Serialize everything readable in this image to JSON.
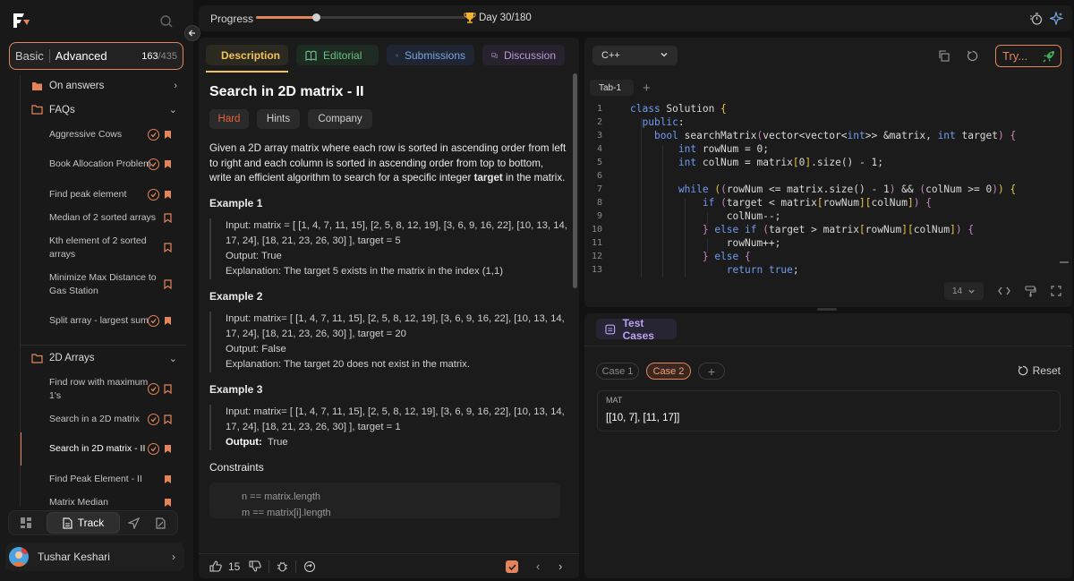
{
  "sidebar": {
    "mode_basic": "Basic",
    "mode_advanced": "Advanced",
    "count_done": "163",
    "count_total": "/435",
    "items": [
      {
        "type": "folder",
        "label": "On answers",
        "expanded": false
      },
      {
        "type": "folder",
        "label": "FAQs",
        "expanded": true
      },
      {
        "type": "problem",
        "label": "Aggressive Cows",
        "solved": true,
        "bookmarked": true
      },
      {
        "type": "problem",
        "label": "Book Allocation Problem",
        "solved": true,
        "bookmarked": true
      },
      {
        "type": "problem",
        "label": "Find peak element",
        "solved": true,
        "bookmarked": true
      },
      {
        "type": "problem",
        "label": "Median of 2 sorted arrays",
        "solved": false,
        "bookmarked": false
      },
      {
        "type": "problem",
        "label": "Kth element of 2 sorted arrays",
        "solved": false,
        "bookmarked": false
      },
      {
        "type": "problem",
        "label": "Minimize Max Distance to Gas Station",
        "solved": false,
        "bookmarked": false
      },
      {
        "type": "problem",
        "label": "Split array - largest sum",
        "solved": true,
        "bookmarked": true
      },
      {
        "type": "folder",
        "label": "2D Arrays",
        "expanded": true
      },
      {
        "type": "problem",
        "label": "Find row with maximum 1's",
        "solved": true,
        "bookmarked": false
      },
      {
        "type": "problem",
        "label": "Search in a 2D matrix",
        "solved": true,
        "bookmarked": false
      },
      {
        "type": "problem",
        "label": "Search in 2D matrix - II",
        "solved": true,
        "bookmarked": true,
        "active": true
      },
      {
        "type": "problem",
        "label": "Find Peak Element - II",
        "solved": false,
        "bookmarked": true
      },
      {
        "type": "problem",
        "label": "Matrix Median",
        "solved": false,
        "bookmarked": true
      }
    ],
    "bottom_nav": {
      "track_label": "Track"
    },
    "user": {
      "name": "Tushar Keshari"
    }
  },
  "topbar": {
    "progress_label": "Progress",
    "progress_fraction": 0.285,
    "day_label": "Day 30/180"
  },
  "description": {
    "tabs": [
      "Description",
      "Editorial",
      "Submissions",
      "Discussion"
    ],
    "title": "Search in 2D matrix - II",
    "chips": {
      "difficulty": "Hard",
      "hints": "Hints",
      "company": "Company"
    },
    "statement_pre": "Given a 2D array matrix where each row is sorted in ascending order from left to right and each column is sorted in ascending order from top to bottom, write an efficient algorithm to search for a specific integer ",
    "statement_bold": "target",
    "statement_post": " in the matrix.",
    "examples": [
      {
        "title": "Example 1",
        "input": "Input: matrix = [ [1, 4, 7, 11, 15], [2, 5, 8, 12, 19], [3, 6, 9, 16, 22], [10, 13, 14, 17, 24], [18, 21, 23, 26, 30] ], target = 5",
        "output": "Output: True",
        "explanation": "Explanation: The target 5 exists in the matrix in the index (1,1)"
      },
      {
        "title": "Example 2",
        "input": "Input: matrix= [ [1, 4, 7, 11, 15], [2, 5, 8, 12, 19], [3, 6, 9, 16, 22], [10, 13, 14, 17, 24], [18, 21, 23, 26, 30] ], target = 20",
        "output": "Output: False",
        "explanation": "Explanation: The target 20 does not exist in the matrix."
      },
      {
        "title": "Example 3",
        "input": "Input: matrix= [ [1, 4, 7, 11, 15], [2, 5, 8, 12, 19], [3, 6, 9, 16, 22], [10, 13, 14, 17, 24], [18, 21, 23, 26, 30] ], target = 1",
        "output_label": "Output:",
        "output_value": "True"
      }
    ],
    "constraints_title": "Constraints",
    "constraints": [
      "n == matrix.length",
      "m == matrix[i].length"
    ],
    "footer": {
      "likes": "15"
    }
  },
  "editor": {
    "language": "C++",
    "try_label": "Try...",
    "tab_name": "Tab-1",
    "font_size": "14"
  },
  "tests": {
    "tab_label": "Test Cases",
    "cases": [
      "Case 1",
      "Case 2"
    ],
    "reset_label": "Reset",
    "input_label": "MAT",
    "input_value": "[[10, 7], [11, 17]]"
  },
  "colors": {
    "accent": "#e3845a",
    "description_tab": "#f0c35a",
    "editorial_tab": "#6abf86",
    "submissions_tab": "#7aa5e0",
    "discussion_tab": "#b69ad6"
  }
}
